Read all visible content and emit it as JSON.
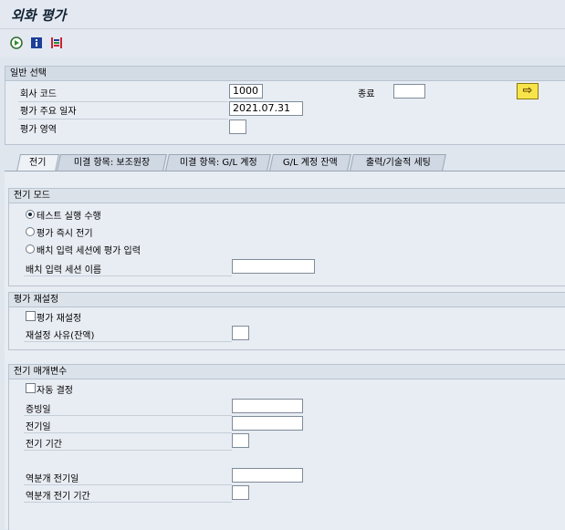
{
  "title": "외화 평가",
  "toolbar": {
    "execute_icon": "execute-clock-icon",
    "info_icon": "info-icon",
    "variant_icon": "variant-icon"
  },
  "general": {
    "header": "일반 선택",
    "company_code_label": "회사 코드",
    "company_code_value": "1000",
    "end_label": "종료",
    "end_value": "",
    "valuation_date_label": "평가 주요 일자",
    "valuation_date_value": "2021.07.31",
    "valuation_area_label": "평가 영역",
    "valuation_area_value": "",
    "exec_button_glyph": "⇨"
  },
  "tabs": [
    {
      "label": "전기"
    },
    {
      "label": "미결 항목: 보조원장"
    },
    {
      "label": "미결 항목: G/L 계정"
    },
    {
      "label": "G/L 계정 잔액"
    },
    {
      "label": "출력/기술적 세팅"
    }
  ],
  "posting_mode": {
    "header": "전기 모드",
    "options": [
      {
        "label": "테스트 실행 수행",
        "selected": true
      },
      {
        "label": "평가 즉시 전기",
        "selected": false
      },
      {
        "label": "배치 입력 세션에 평가 입력",
        "selected": false
      }
    ],
    "session_name_label": "배치 입력 세션 이름",
    "session_name_value": ""
  },
  "reset": {
    "header": "평가 재설정",
    "checkbox_label": "평가 재설정",
    "reason_label": "재설정 사유(잔액)",
    "reason_value": ""
  },
  "params": {
    "header": "전기 매개변수",
    "auto_label": "자동 결정",
    "doc_date_label": "증빙일",
    "doc_date_value": "",
    "posting_date_label": "전기일",
    "posting_date_value": "",
    "period_label": "전기 기간",
    "period_value": "",
    "reverse_date_label": "역분개 전기일",
    "reverse_date_value": "",
    "reverse_period_label": "역분개 전기 기간",
    "reverse_period_value": ""
  }
}
